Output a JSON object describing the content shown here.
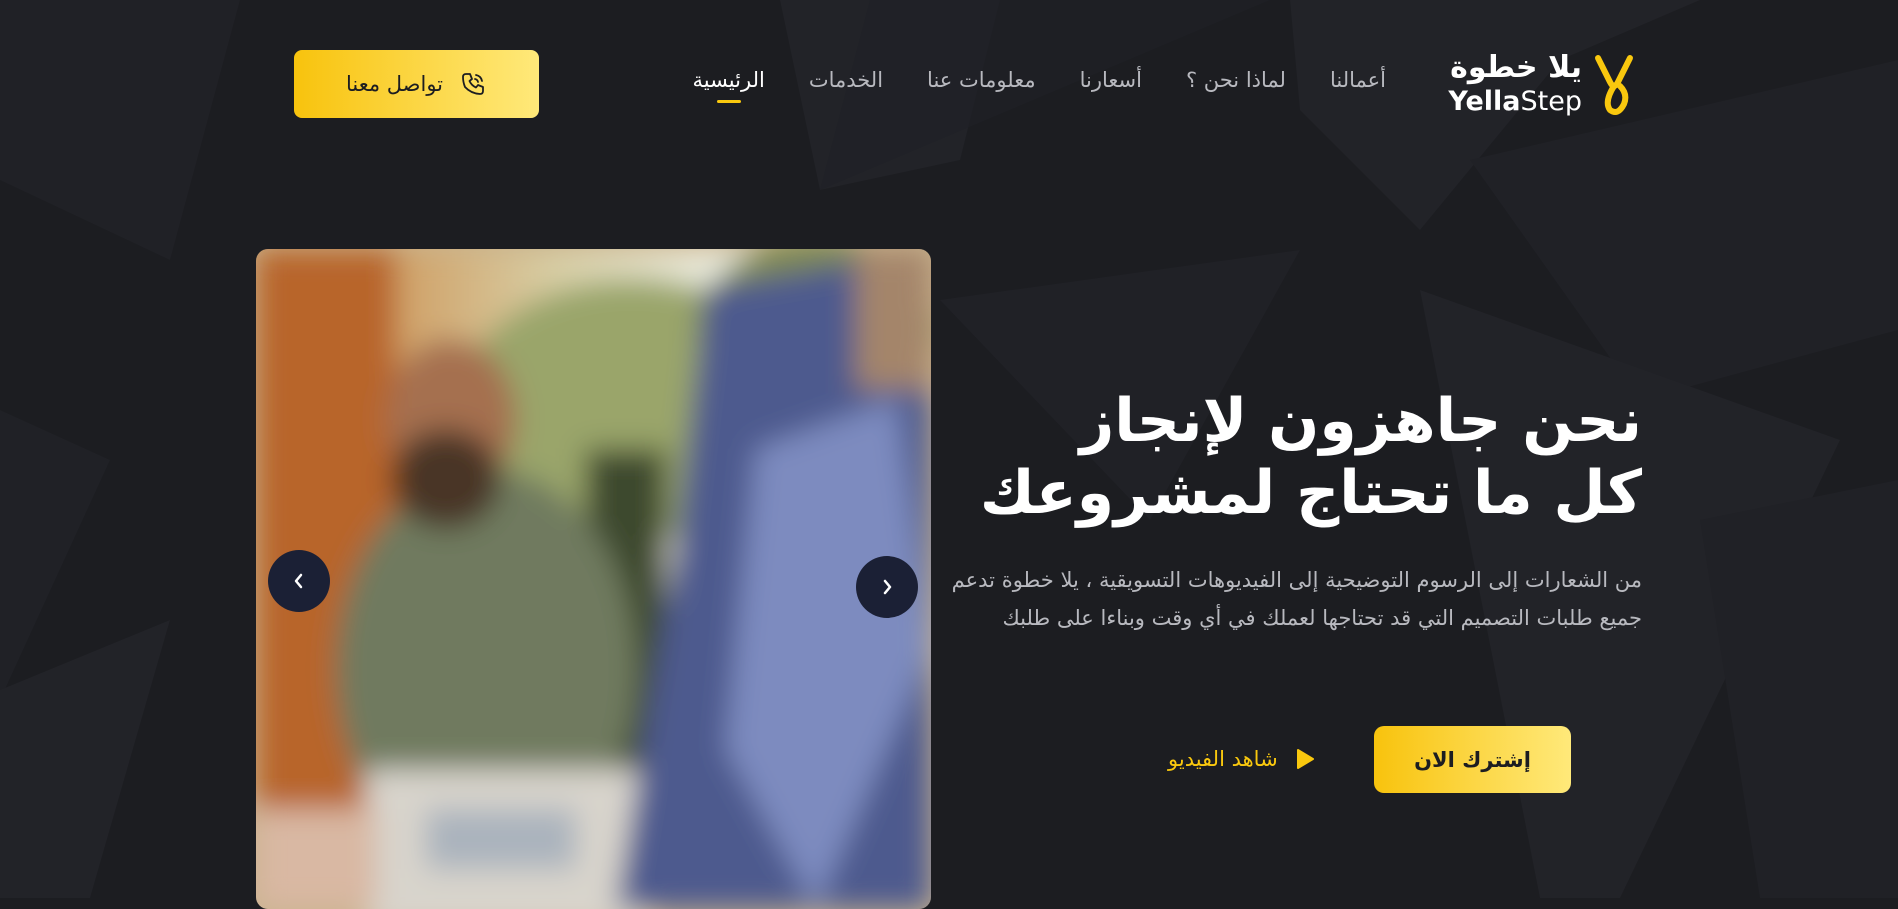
{
  "brand": {
    "name_ar": "يلا خطوة",
    "name_en_bold": "Yella",
    "name_en_light": "Step",
    "accent_color": "#f9c80e"
  },
  "nav": {
    "items": [
      {
        "label": "الرئيسية",
        "active": true
      },
      {
        "label": "الخدمات",
        "active": false
      },
      {
        "label": "معلومات عنا",
        "active": false
      },
      {
        "label": "أسعارنا",
        "active": false
      },
      {
        "label": "لماذا نحن ؟",
        "active": false
      },
      {
        "label": "أعمالنا",
        "active": false
      }
    ]
  },
  "contact_button": {
    "label": "تواصل معنا",
    "icon": "phone-icon"
  },
  "hero": {
    "headline_line1": "نحن جاهزون لإنجاز",
    "headline_line2": "كل ما تحتاج لمشروعك",
    "description": "من الشعارات إلى الرسوم التوضيحية إلى الفيديوهات التسويقية ، يلا خطوة تدعم جميع طلبات التصميم التي قد تحتاجها لعملك في أي وقت وبناءا على طلبك",
    "subscribe_label": "إشترك الان",
    "video_label": "شاهد الفيديو",
    "slider_prev_icon": "chevron-left-icon",
    "slider_next_icon": "chevron-right-icon"
  }
}
